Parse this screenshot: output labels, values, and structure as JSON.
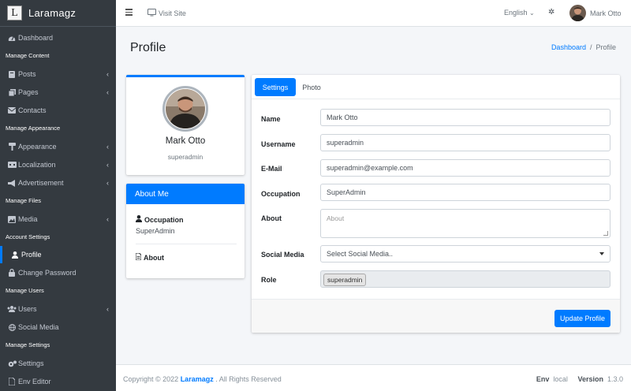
{
  "brand": {
    "logo_letter": "L",
    "name": "Laramagz"
  },
  "sidebar": {
    "items": [
      {
        "type": "item",
        "label": "Dashboard",
        "icon": "dashboard-icon"
      },
      {
        "type": "header",
        "label": "Manage Content"
      },
      {
        "type": "item",
        "label": "Posts",
        "icon": "book-icon",
        "expandable": true
      },
      {
        "type": "item",
        "label": "Pages",
        "icon": "copy-icon",
        "expandable": true
      },
      {
        "type": "item",
        "label": "Contacts",
        "icon": "envelope-icon"
      },
      {
        "type": "header",
        "label": "Manage Appearance"
      },
      {
        "type": "item",
        "label": "Appearance",
        "icon": "paint-roller-icon",
        "expandable": true
      },
      {
        "type": "item",
        "label": "Localization",
        "icon": "language-icon",
        "expandable": true
      },
      {
        "type": "item",
        "label": "Advertisement",
        "icon": "bullhorn-icon",
        "expandable": true
      },
      {
        "type": "header",
        "label": "Manage Files"
      },
      {
        "type": "item",
        "label": "Media",
        "icon": "photo-video-icon",
        "expandable": true
      },
      {
        "type": "header",
        "label": "Account Settings"
      },
      {
        "type": "item",
        "label": "Profile",
        "icon": "user-icon",
        "active": true
      },
      {
        "type": "item",
        "label": "Change Password",
        "icon": "lock-icon"
      },
      {
        "type": "header",
        "label": "Manage Users"
      },
      {
        "type": "item",
        "label": "Users",
        "icon": "users-icon",
        "expandable": true
      },
      {
        "type": "item",
        "label": "Social Media",
        "icon": "globe-icon"
      },
      {
        "type": "header",
        "label": "Manage Settings"
      },
      {
        "type": "item",
        "label": "Settings",
        "icon": "cogs-icon"
      },
      {
        "type": "item",
        "label": "Env Editor",
        "icon": "file-icon"
      }
    ]
  },
  "topbar": {
    "visit_site": "Visit Site",
    "language": "English",
    "user_name": "Mark Otto"
  },
  "page": {
    "title": "Profile",
    "breadcrumb": {
      "home": "Dashboard",
      "separator": "/",
      "current": "Profile"
    }
  },
  "profile": {
    "name": "Mark Otto",
    "role": "superadmin"
  },
  "about": {
    "title": "About Me",
    "occupation_label": "Occupation",
    "occupation_value": "SuperAdmin",
    "about_label": "About"
  },
  "tabs": {
    "settings": "Settings",
    "photo": "Photo"
  },
  "form": {
    "name_label": "Name",
    "name_value": "Mark Otto",
    "username_label": "Username",
    "username_value": "superadmin",
    "email_label": "E-Mail",
    "email_value": "superadmin@example.com",
    "occupation_label": "Occupation",
    "occupation_value": "SuperAdmin",
    "about_label": "About",
    "about_placeholder": "About",
    "social_label": "Social Media",
    "social_placeholder": "Select Social Media..",
    "role_label": "Role",
    "role_value": "superadmin",
    "submit": "Update Profile"
  },
  "footer": {
    "copyright_prefix": "Copyright © 2022",
    "brand": "Laramagz",
    "suffix": ". All Rights Reserved",
    "env_label": "Env",
    "env_value": "local",
    "version_label": "Version",
    "version_value": "1.3.0"
  },
  "colors": {
    "primary": "#007bff",
    "sidebar_bg": "#343a40"
  }
}
